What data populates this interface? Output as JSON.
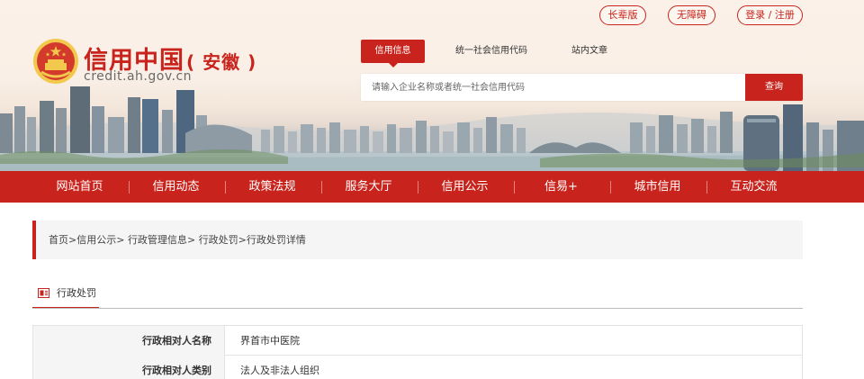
{
  "top_links": {
    "elder": "长辈版",
    "accessible": "无障碍",
    "login": "登录 / 注册"
  },
  "logo": {
    "title": "信用中国",
    "region": "( 安徽 )",
    "domain": "credit.ah.gov.cn"
  },
  "search": {
    "tabs": [
      "信用信息",
      "统一社会信用代码",
      "站内文章"
    ],
    "placeholder": "请输入企业名称或者统一社会信用代码",
    "button": "查询"
  },
  "nav": [
    "网站首页",
    "信用动态",
    "政策法规",
    "服务大厅",
    "信用公示",
    "信易+",
    "城市信用",
    "互动交流"
  ],
  "breadcrumb": {
    "items": [
      "首页",
      "信用公示",
      "行政管理信息",
      "行政处罚",
      "行政处罚详情"
    ],
    "sep": ">"
  },
  "section": {
    "title": "行政处罚"
  },
  "detail_rows": [
    {
      "label": "行政相对人名称",
      "value": "界首市中医院"
    },
    {
      "label": "行政相对人类别",
      "value": "法人及非法人组织"
    }
  ],
  "colors": {
    "brand_red": "#c8241d",
    "crumb_bg": "#f5f5f5"
  }
}
